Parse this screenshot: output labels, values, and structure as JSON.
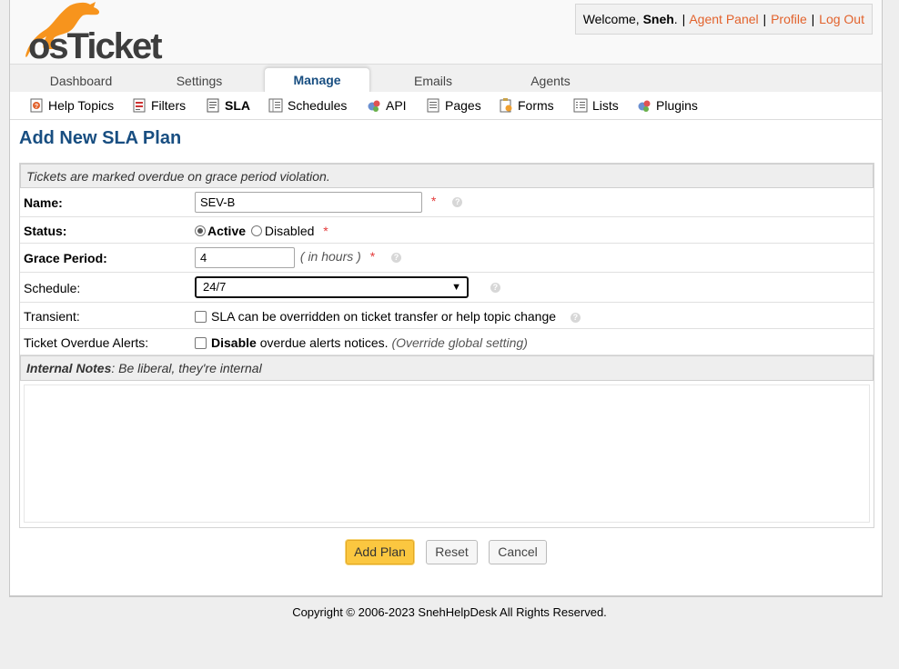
{
  "brand": {
    "logo_text": "osTicket"
  },
  "user_info": {
    "welcome_label": "Welcome,",
    "username": "Sneh",
    "links": [
      "Agent Panel",
      "Profile",
      "Log Out"
    ]
  },
  "nav": {
    "tabs": [
      "Dashboard",
      "Settings",
      "Manage",
      "Emails",
      "Agents"
    ],
    "active": "Manage"
  },
  "subnav": {
    "items": [
      {
        "label": "Help Topics",
        "icon": "help-topics-icon"
      },
      {
        "label": "Filters",
        "icon": "filters-icon"
      },
      {
        "label": "SLA",
        "icon": "sla-icon"
      },
      {
        "label": "Schedules",
        "icon": "schedules-icon"
      },
      {
        "label": "API",
        "icon": "api-icon"
      },
      {
        "label": "Pages",
        "icon": "pages-icon"
      },
      {
        "label": "Forms",
        "icon": "forms-icon"
      },
      {
        "label": "Lists",
        "icon": "lists-icon"
      },
      {
        "label": "Plugins",
        "icon": "plugins-icon"
      }
    ],
    "active": "SLA"
  },
  "page": {
    "title": "Add New SLA Plan"
  },
  "form": {
    "intro": "Tickets are marked overdue on grace period violation.",
    "name": {
      "label": "Name:",
      "value": "SEV-B"
    },
    "status": {
      "label": "Status:",
      "options": [
        "Active",
        "Disabled"
      ],
      "selected": "Active"
    },
    "grace": {
      "label": "Grace Period:",
      "value": "4",
      "hint": "( in hours )"
    },
    "schedule": {
      "label": "Schedule:",
      "value": "24/7"
    },
    "transient": {
      "label": "Transient:",
      "text": "SLA can be overridden on ticket transfer or help topic change",
      "checked": false
    },
    "overdue_alerts": {
      "label": "Ticket Overdue Alerts:",
      "bold_text": "Disable",
      "text": "overdue alerts notices.",
      "hint": "(Override global setting)",
      "checked": false
    },
    "notes": {
      "label": "Internal Notes",
      "hint": ": Be liberal, they're internal",
      "value": ""
    },
    "required_mark": "*",
    "help_mark": "?"
  },
  "buttons": {
    "submit": "Add Plan",
    "reset": "Reset",
    "cancel": "Cancel"
  },
  "footer": {
    "text": "Copyright © 2006-2023 SnehHelpDesk All Rights Reserved."
  },
  "colors": {
    "brand_blue": "#184e81",
    "link_orange": "#e2622c",
    "logo_orange": "#f7941d",
    "logo_dark": "#3d3d3d",
    "primary_button": "#fbc740"
  }
}
